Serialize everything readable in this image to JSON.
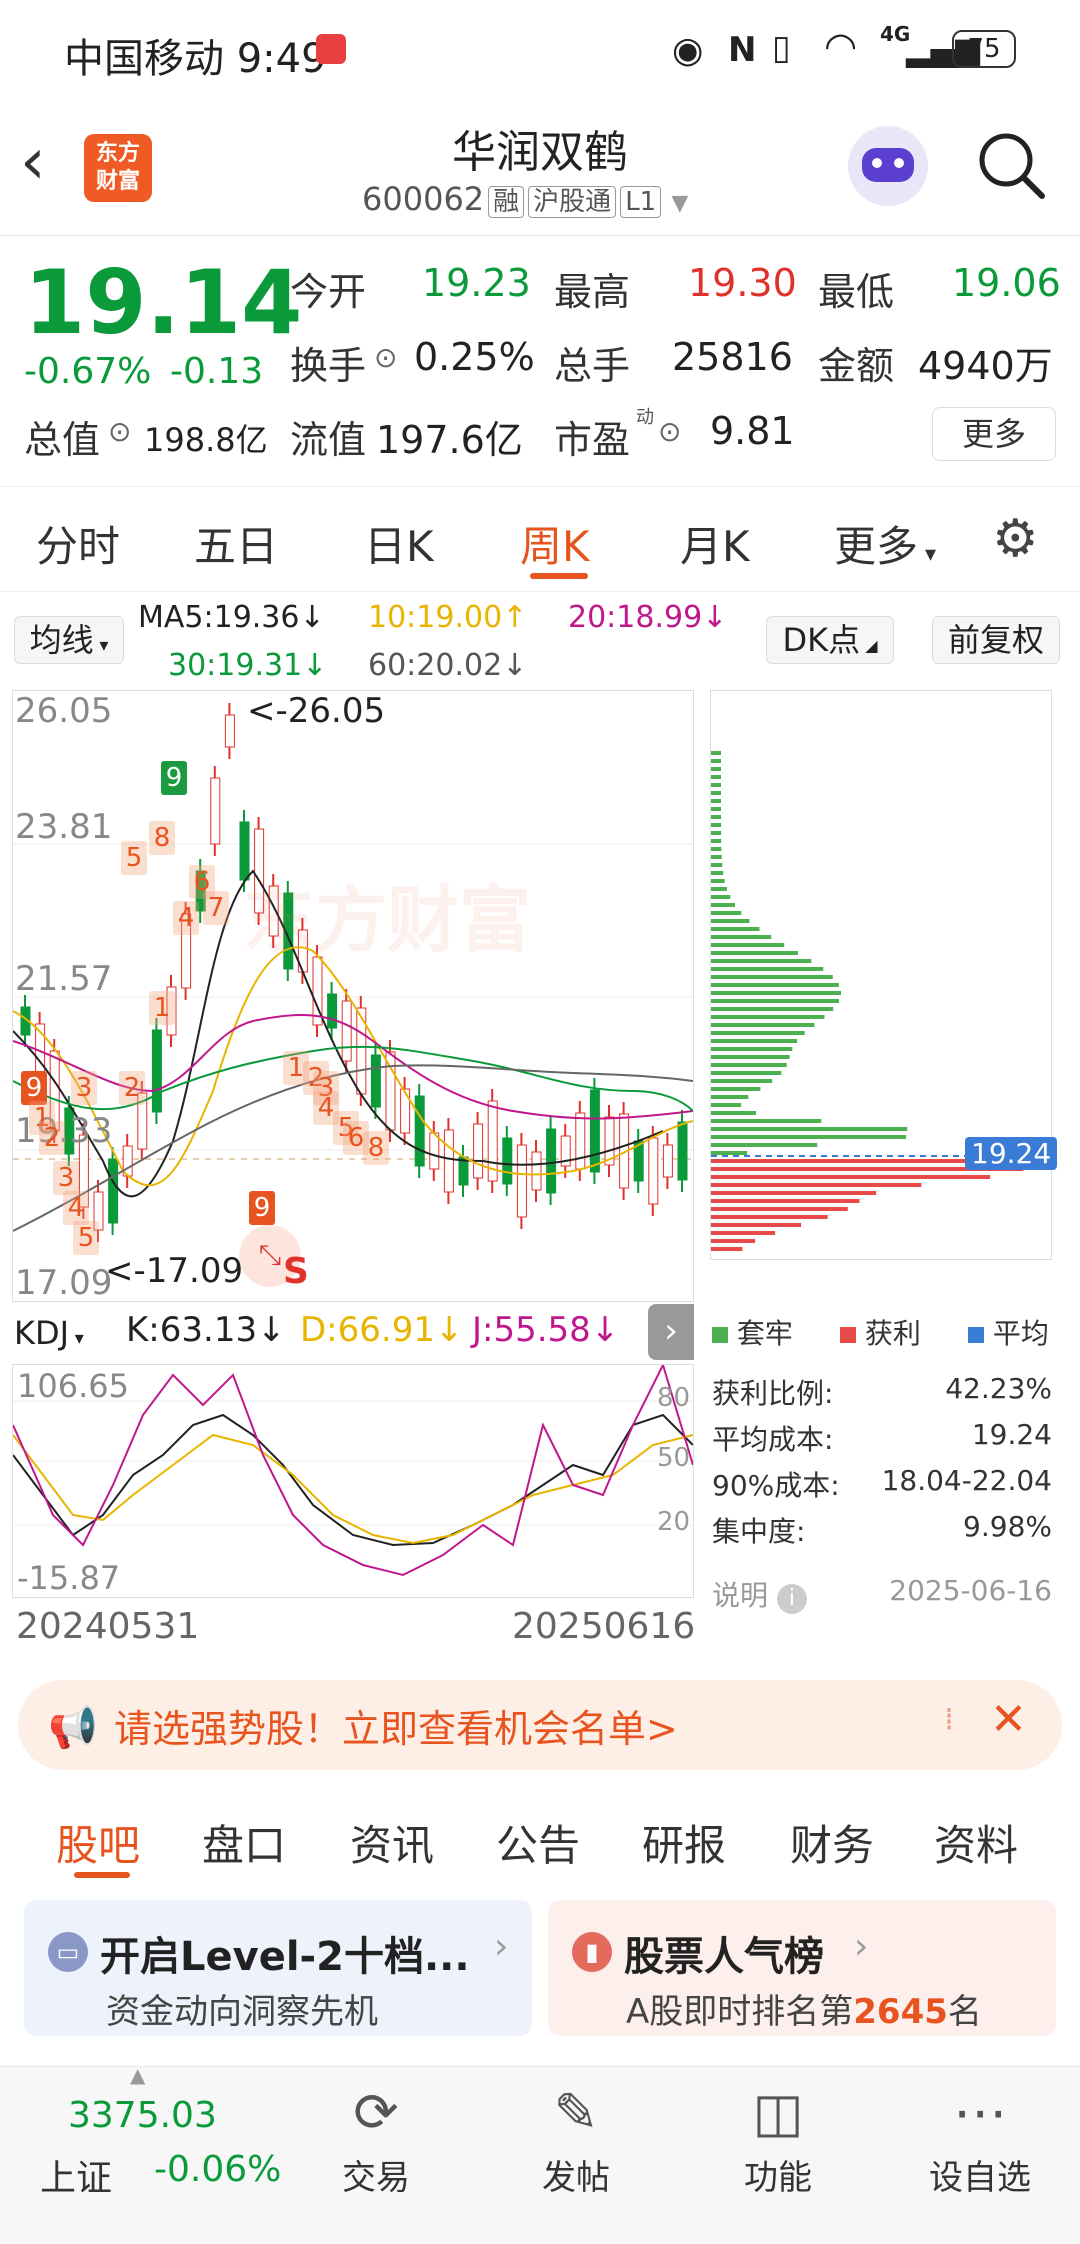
{
  "status": {
    "carrier_time": "中国移动 9:49",
    "battery": "75",
    "network": "4G"
  },
  "header": {
    "logo": [
      "东方",
      "财富"
    ],
    "stock_name": "华润双鹤",
    "stock_code": "600062",
    "tags": [
      "融",
      "沪股通",
      "L1"
    ]
  },
  "quote": {
    "price": "19.14",
    "change_pct": "-0.67%",
    "change": "-0.13",
    "open_label": "今开",
    "open": "19.23",
    "high_label": "最高",
    "high": "19.30",
    "low_label": "最低",
    "low": "19.06",
    "turnover_label": "换手",
    "turnover": "0.25%",
    "volume_label": "总手",
    "volume": "25816",
    "amount_label": "金额",
    "amount": "4940万",
    "mktcap_label": "总值",
    "mktcap": "198.8亿",
    "float_label": "流值",
    "float": "197.6亿",
    "pe_label": "市盈",
    "pe_sup": "动",
    "pe": "9.81",
    "more_label": "更多"
  },
  "period_tabs": [
    "分时",
    "五日",
    "日K",
    "周K",
    "月K",
    "更多"
  ],
  "indicators": {
    "ma_select": "均线",
    "ma5": "MA5:19.36↓",
    "ma10": "10:19.00↑",
    "ma20": "20:18.99↓",
    "ma30": "30:19.31↓",
    "ma60": "60:20.02↓",
    "dk_select": "DK点",
    "adjust": "前复权",
    "colors": {
      "ma5": "#222222",
      "ma10": "#e8b400",
      "ma20": "#c0188c",
      "ma30": "#0a9a3a",
      "ma60": "#666666"
    }
  },
  "kline": {
    "y_labels": [
      "26.05",
      "23.81",
      "21.57",
      "19.33",
      "17.09"
    ],
    "high_note": "<-26.05",
    "low_note": "<-17.09",
    "s_marker": "S",
    "watermark": "东方财富",
    "markers": [
      "9",
      "8",
      "5",
      "6",
      "7",
      "4",
      "1",
      "2",
      "3",
      "9",
      "1",
      "2",
      "3",
      "4",
      "5",
      "6",
      "8",
      "9",
      "1",
      "2",
      "3",
      "4",
      "5"
    ]
  },
  "kdj": {
    "select": "KDJ",
    "k": "K:63.13↓",
    "d": "D:66.91↓",
    "j": "J:55.58↓",
    "y_top": "106.65",
    "y_bottom": "-15.87",
    "levels": [
      "80",
      "50",
      "20"
    ],
    "date_start": "20240531",
    "date_end": "20250616"
  },
  "chips": {
    "current": "19.24",
    "legend": [
      "套牢",
      "获利",
      "平均"
    ],
    "legend_colors": [
      "#4caf50",
      "#e84a4a",
      "#3a7bd5"
    ],
    "rows": [
      {
        "label": "获利比例:",
        "value": "42.23%"
      },
      {
        "label": "平均成本:",
        "value": "19.24"
      },
      {
        "label": "90%成本:",
        "value": "18.04-22.04"
      },
      {
        "label": "集中度:",
        "value": "9.98%"
      }
    ],
    "note": "说明",
    "date": "2025-06-16"
  },
  "banner": {
    "text": "请选强势股！立即查看机会名单>"
  },
  "bottom_tabs": [
    "股吧",
    "盘口",
    "资讯",
    "公告",
    "研报",
    "财务",
    "资料"
  ],
  "cards": [
    {
      "title": "开启Level-2十档...",
      "subtitle": "资金动向洞察先机"
    },
    {
      "title": "股票人气榜",
      "subtitle_prefix": "A股即时排名第",
      "rank": "2645",
      "subtitle_suffix": "名"
    }
  ],
  "footer": {
    "index_value": "3375.03",
    "index_name": "上证",
    "index_change": "-0.06%",
    "items": [
      "交易",
      "发帖",
      "功能",
      "设自选"
    ]
  }
}
